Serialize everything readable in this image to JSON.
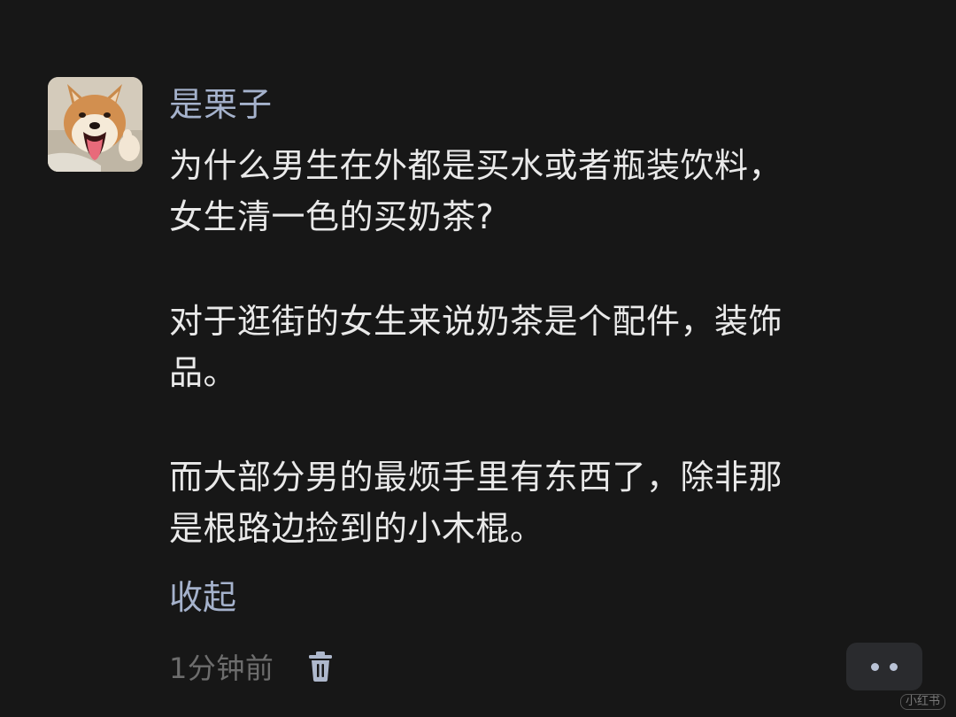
{
  "comment": {
    "username": "是栗子",
    "paragraphs": [
      {
        "lines": [
          "为什么男生在外都是买水或者瓶装饮料，",
          "女生清一色的买奶茶?"
        ]
      },
      {
        "lines": [
          "对于逛街的女生来说奶茶是个配件，装饰",
          "品。"
        ]
      },
      {
        "lines": [
          "而大部分男的最烦手里有东西了，除非那",
          "是根路边捡到的小木棍。"
        ]
      }
    ],
    "collapse_label": "收起",
    "timestamp": "1分钟前",
    "delete_icon": "trash-icon",
    "more_icon": "more-dots-icon",
    "avatar_image": "shiba-inu-dog-photo"
  },
  "watermark": "小红书",
  "colors": {
    "background": "#171717",
    "username": "#a5b2cc",
    "body_text": "#e9e9e9",
    "timestamp": "#6d6d6d",
    "more_button_bg": "#2a2b2e"
  }
}
